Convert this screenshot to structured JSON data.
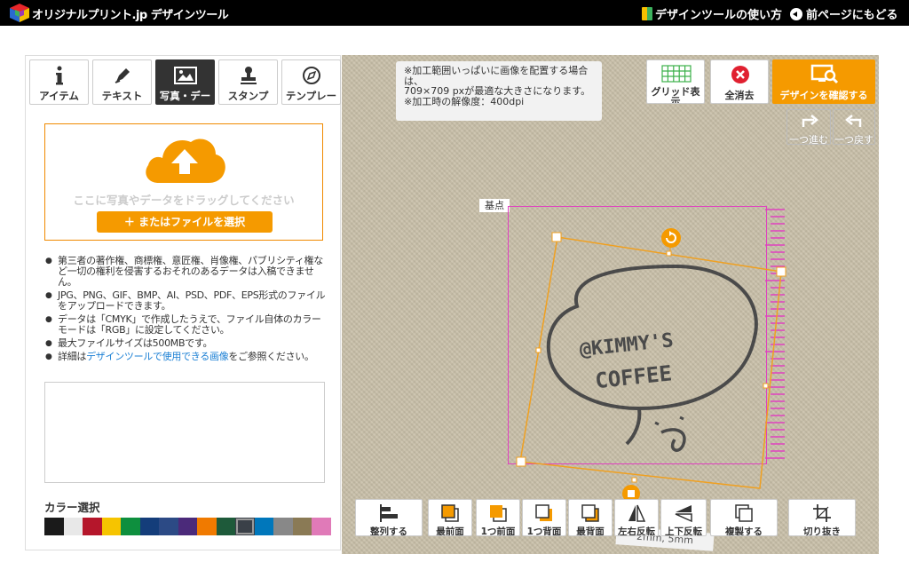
{
  "header": {
    "app_title": "オリジナルプリント.jp デザインツール",
    "help_link": "デザインツールの使い方",
    "back_link": "前ページにもどる"
  },
  "tabs": [
    {
      "label": "アイテム",
      "icon": "info-icon",
      "active": false
    },
    {
      "label": "テキスト",
      "icon": "pen-icon",
      "active": false
    },
    {
      "label": "写真・デー",
      "icon": "image-icon",
      "active": true
    },
    {
      "label": "スタンプ",
      "icon": "stamp-icon",
      "active": false
    },
    {
      "label": "テンプレー",
      "icon": "template-icon",
      "active": false
    }
  ],
  "upload": {
    "drop_text": "ここに写真やデータをドラッグしてください",
    "button_label": "＋ またはファイルを選択"
  },
  "notes": [
    "第三者の著作権、商標権、意匠権、肖像権、パブリシティ権など一切の権利を侵害するおそれのあるデータは入稿できません。",
    "JPG、PNG、GIF、BMP、AI、PSD、PDF、EPS形式のファイルをアップロードできます。",
    "データは「CMYK」で作成したうえで、ファイル自体のカラーモードは「RGB」に設定してください。",
    "最大ファイルサイズは500MBです。"
  ],
  "note_link": {
    "prefix": "詳細は",
    "link_text": "デザインツールで使用できる画像",
    "suffix": "をご参照ください。"
  },
  "color_section": {
    "title": "カラー選択",
    "swatches": [
      "#1a1a1a",
      "#e8e8e8",
      "#b5162b",
      "#f6c400",
      "#0e8f3e",
      "#143d7a",
      "#2c4a85",
      "#4b2a7a",
      "#f07a00",
      "#1e5a3a",
      "#3a4048",
      "#0077bb",
      "#888888",
      "#8a7a55",
      "#e07ab8"
    ]
  },
  "info": {
    "text": "※加工範囲いっぱいに画像を配置する場合は、\n709×709 pxが最適な大きさになります。\n※加工時の解像度：400dpi"
  },
  "toolbar_top": {
    "grid_label": "グリッド表示",
    "clear_label": "全消去",
    "confirm_label": "デザインを確認する",
    "redo_label": "一つ進む",
    "undo_label": "一つ戻す"
  },
  "canvas": {
    "origin_label": "基点",
    "design_text_line1": "@KIMMY'S",
    "design_text_line2": "COFFEE",
    "size_label": "2mm, 5mm"
  },
  "toolbar_bottom": [
    {
      "label": "整列する",
      "icon": "align-icon"
    },
    {
      "label": "最前面",
      "icon": "bring-front-icon"
    },
    {
      "label": "1つ前面",
      "icon": "forward-one-icon"
    },
    {
      "label": "1つ背面",
      "icon": "backward-one-icon"
    },
    {
      "label": "最背面",
      "icon": "send-back-icon"
    },
    {
      "label": "左右反転",
      "icon": "flip-horizontal-icon"
    },
    {
      "label": "上下反転",
      "icon": "flip-vertical-icon"
    },
    {
      "label": "複製する",
      "icon": "duplicate-icon"
    },
    {
      "label": "切り抜き",
      "icon": "crop-icon"
    }
  ],
  "colors": {
    "accent": "#f59a00",
    "selection": "#f0a020",
    "print_area": "#e040c0"
  }
}
